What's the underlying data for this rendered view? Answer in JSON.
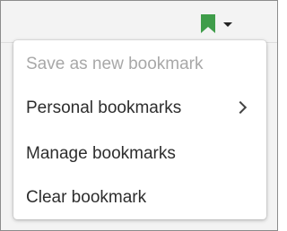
{
  "toolbar": {
    "bookmark_icon": "bookmark-icon",
    "dropdown_icon": "caret-down-icon",
    "bookmark_color": "#3f9d4a"
  },
  "menu": {
    "items": [
      {
        "label": "Save as new bookmark",
        "disabled": true
      },
      {
        "label": "Personal bookmarks",
        "has_submenu": true,
        "submenu_icon": "chevron-right-icon"
      },
      {
        "label": "Manage bookmarks"
      },
      {
        "label": "Clear bookmark"
      }
    ]
  }
}
